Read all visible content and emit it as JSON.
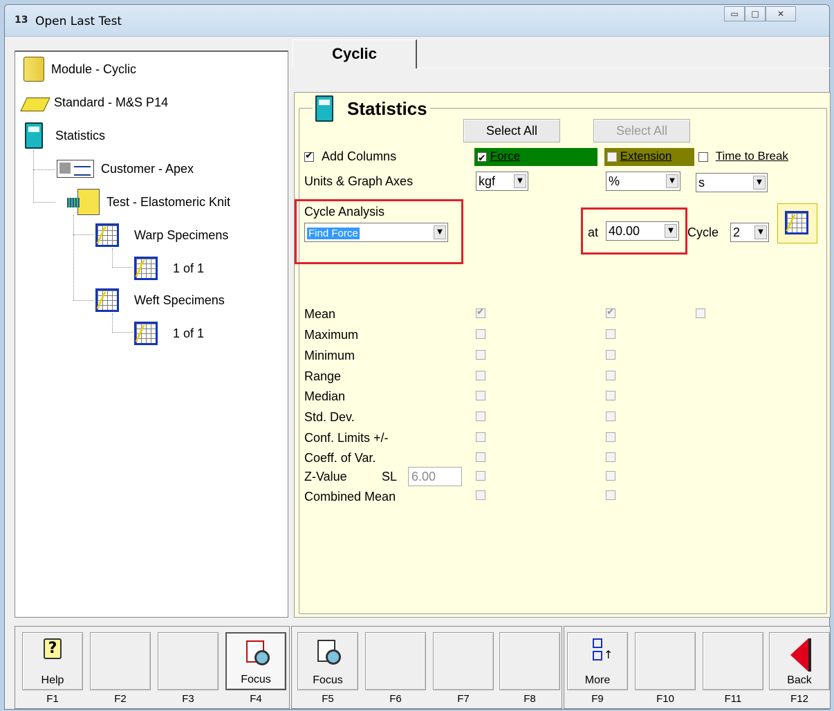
{
  "window": {
    "title": "Open Last Test",
    "app_icon": "13",
    "minimize_glyph": "▭",
    "maximize_glyph": "□",
    "close_glyph": "✕"
  },
  "tree": {
    "items": [
      {
        "label": "Module - Cyclic",
        "icon": "module-icon"
      },
      {
        "label": "Standard - M&S P14",
        "icon": "standard-book-icon"
      },
      {
        "label": "Statistics",
        "icon": "calculator-icon"
      },
      {
        "label": "Customer - Apex",
        "icon": "customer-card-icon"
      },
      {
        "label": "Test - Elastomeric Knit",
        "icon": "test-document-icon"
      },
      {
        "label": "Warp Specimens",
        "icon": "graph-icon"
      },
      {
        "label": "1 of 1",
        "icon": "graph-icon"
      },
      {
        "label": "Weft Specimens",
        "icon": "graph-icon"
      },
      {
        "label": "1 of 1",
        "icon": "graph-icon"
      }
    ]
  },
  "tab": {
    "label": "Cyclic"
  },
  "stats": {
    "title": "Statistics",
    "select_all_1": "Select All",
    "select_all_2": "Select All",
    "add_columns_label": "Add Columns",
    "columns": {
      "force": "Force",
      "extension": "Extension",
      "time_to_break": "Time to Break"
    },
    "column_colors": {
      "force": "#008000",
      "extension": "#808000"
    },
    "units_label": "Units & Graph Axes",
    "units": {
      "force": "kgf",
      "extension": "%",
      "time": "s"
    },
    "cycle_analysis_label": "Cycle Analysis",
    "cycle_analysis_value": "Find Force",
    "at_label": "at",
    "at_value": "40.00",
    "cycle_label": "Cycle",
    "cycle_value": "2",
    "rows": [
      "Mean",
      "Maximum",
      "Minimum",
      "Range",
      "Median",
      "Std. Dev.",
      "Conf. Limits +/-",
      "Coeff. of Var.",
      "Z-Value",
      "Combined Mean"
    ],
    "sl_label": "SL",
    "sl_value": "6.00"
  },
  "fkeys": [
    {
      "key": "F1",
      "caption": "Help"
    },
    {
      "key": "F2",
      "caption": ""
    },
    {
      "key": "F3",
      "caption": ""
    },
    {
      "key": "F4",
      "caption": "Focus"
    },
    {
      "key": "F5",
      "caption": "Focus"
    },
    {
      "key": "F6",
      "caption": ""
    },
    {
      "key": "F7",
      "caption": ""
    },
    {
      "key": "F8",
      "caption": ""
    },
    {
      "key": "F9",
      "caption": "More"
    },
    {
      "key": "F10",
      "caption": ""
    },
    {
      "key": "F11",
      "caption": ""
    },
    {
      "key": "F12",
      "caption": "Back"
    }
  ],
  "colors": {
    "panel_bg": "#ffffe1",
    "highlight_red": "#e0202a",
    "selection_blue": "#3399ff"
  }
}
